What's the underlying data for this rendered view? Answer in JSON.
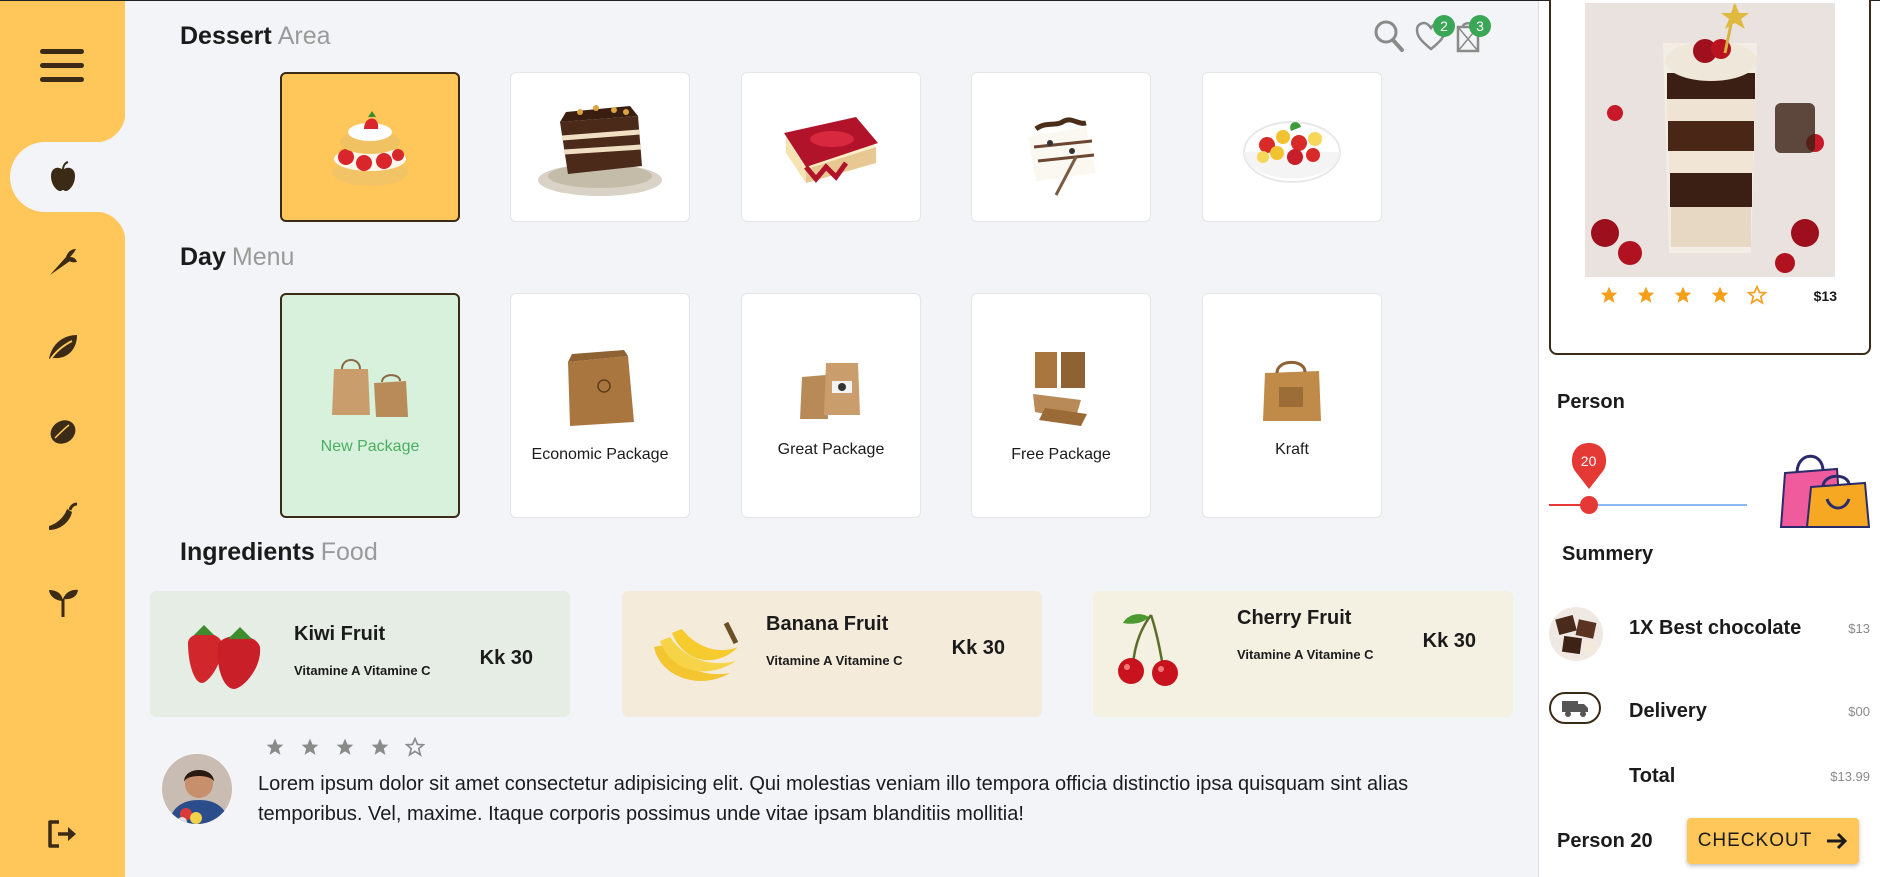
{
  "dessert": {
    "title": "Dessert",
    "subtitle": "Area"
  },
  "top_icons": {
    "favorites_count": "2",
    "cart_count": "3"
  },
  "day": {
    "title": "Day",
    "subtitle": "Menu",
    "packages": [
      {
        "label": "New Package"
      },
      {
        "label": "Economic Package"
      },
      {
        "label": "Great Package"
      },
      {
        "label": "Free Package"
      },
      {
        "label": "Kraft"
      }
    ]
  },
  "ingredients": {
    "title": "Ingredients",
    "subtitle": "Food",
    "items": [
      {
        "name": "Kiwi Fruit",
        "vitamins": "Vitamine A Vitamine C",
        "price": "Kk 30"
      },
      {
        "name": "Banana Fruit",
        "vitamins": "Vitamine A Vitamine C",
        "price": "Kk 30"
      },
      {
        "name": "Cherry Fruit",
        "vitamins": "Vitamine A Vitamine C",
        "price": "Kk 30"
      }
    ]
  },
  "review": {
    "rating": 4,
    "text": "Lorem ipsum dolor sit amet consectetur adipisicing elit. Qui molestias veniam illo tempora officia distinctio ipsa quisquam sint alias temporibus. Vel, maxime. Itaque corporis possimus unde vitae ipsam blanditiis mollitia!"
  },
  "promo": {
    "rating": 4,
    "price": "$13"
  },
  "person": {
    "label": "Person",
    "value": "20",
    "fraction": 0.2
  },
  "summary": {
    "label": "Summery",
    "item_label": "1X Best chocolate",
    "item_price": "$13",
    "delivery_label": "Delivery",
    "delivery_price": "$00",
    "total_label": "Total",
    "total_price": "$13.99"
  },
  "footer": {
    "person_summary": "Person 20",
    "checkout_label": "CHECKOUT"
  },
  "colors": {
    "accent": "#ffc65a",
    "dark": "#3a2a16",
    "badge": "#3aa757",
    "slider": "#e53935"
  },
  "sidebar_icons": [
    "menu-icon",
    "apple-icon",
    "carrot-icon",
    "leaf-icon",
    "lemon-icon",
    "chili-icon",
    "sprout-icon",
    "logout-icon"
  ]
}
